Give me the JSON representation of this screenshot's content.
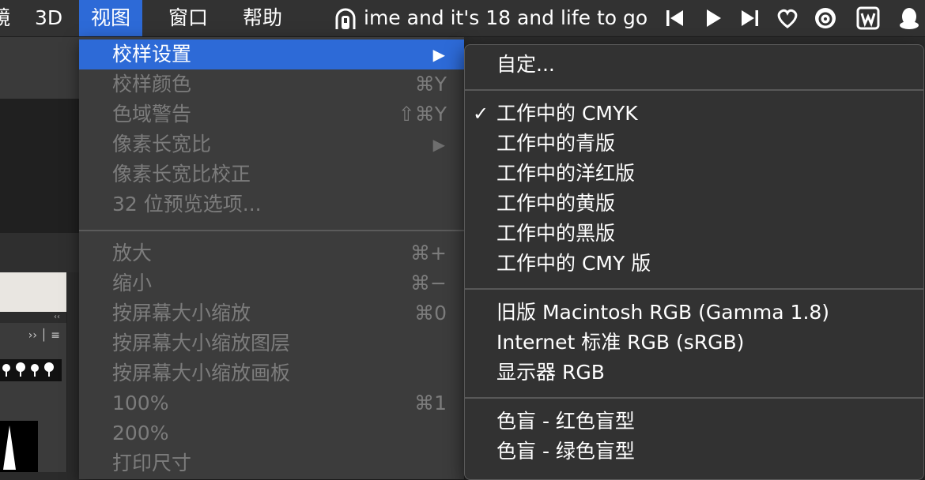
{
  "menubar": {
    "items": [
      {
        "label": "镜"
      },
      {
        "label": "3D"
      },
      {
        "label": "视图"
      },
      {
        "label": "窗口"
      },
      {
        "label": "帮助"
      }
    ],
    "now_playing": "ime and it's 18 and life to go",
    "status_icons": [
      "podcast-icon",
      "prev-track-icon",
      "play-icon",
      "next-track-icon",
      "heart-icon",
      "netease-music-icon",
      "wps-icon",
      "qq-icon"
    ]
  },
  "background_panel": {
    "collapse_label": "‹‹",
    "row_label": "›› │ ≡"
  },
  "view_menu": {
    "items": [
      {
        "label": "校样设置",
        "shortcut": "",
        "submenu": true,
        "highlighted": true
      },
      {
        "label": "校样颜色",
        "shortcut": "⌘Y"
      },
      {
        "label": "色域警告",
        "shortcut": "⇧⌘Y"
      },
      {
        "label": "像素长宽比",
        "shortcut": "",
        "submenu": true
      },
      {
        "label": "像素长宽比校正",
        "shortcut": ""
      },
      {
        "label": "32 位预览选项...",
        "shortcut": ""
      },
      {
        "label": "放大",
        "shortcut": "⌘+"
      },
      {
        "label": "缩小",
        "shortcut": "⌘−"
      },
      {
        "label": "按屏幕大小缩放",
        "shortcut": "⌘0"
      },
      {
        "label": "按屏幕大小缩放图层",
        "shortcut": ""
      },
      {
        "label": "按屏幕大小缩放画板",
        "shortcut": ""
      },
      {
        "label": "100%",
        "shortcut": "⌘1"
      },
      {
        "label": "200%",
        "shortcut": ""
      },
      {
        "label": "打印尺寸",
        "shortcut": ""
      }
    ],
    "arrow_glyph": "▶"
  },
  "proof_submenu": {
    "check_glyph": "✓",
    "items": [
      {
        "label": "自定..."
      },
      {
        "label": "工作中的 CMYK",
        "checked": true
      },
      {
        "label": "工作中的青版"
      },
      {
        "label": "工作中的洋红版"
      },
      {
        "label": "工作中的黄版"
      },
      {
        "label": "工作中的黑版"
      },
      {
        "label": "工作中的 CMY 版"
      },
      {
        "label": "旧版 Macintosh RGB (Gamma 1.8)"
      },
      {
        "label": "Internet 标准 RGB (sRGB)"
      },
      {
        "label": "显示器 RGB"
      },
      {
        "label": "色盲 - 红色盲型"
      },
      {
        "label": "色盲 - 绿色盲型"
      }
    ]
  },
  "colors": {
    "highlight": "#2d6ad7",
    "menubar": "#323232",
    "menu_bg": "#3c3c3c",
    "disabled_text": "#7c7c7c"
  }
}
